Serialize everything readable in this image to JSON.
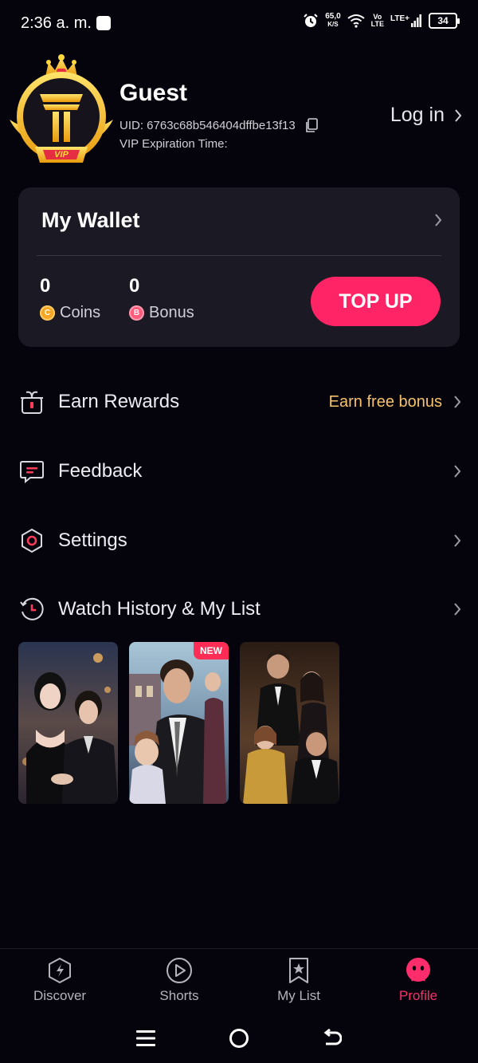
{
  "status_bar": {
    "time": "2:36 a. m.",
    "speed_value": "65,0",
    "speed_unit": "K/S",
    "volte_top": "Vo",
    "volte_bottom": "LTE",
    "lte": "LTE+",
    "battery": "34"
  },
  "profile": {
    "name": "Guest",
    "uid": "UID: 6763c68b546404dffbe13f13",
    "vip_expiration": "VIP Expiration Time:",
    "login_label": "Log in",
    "badge_label": "VIP"
  },
  "wallet": {
    "title": "My Wallet",
    "coins_value": "0",
    "coins_label": "Coins",
    "bonus_value": "0",
    "bonus_label": "Bonus",
    "coin_glyph": "C",
    "bonus_glyph": "B",
    "topup_label": "TOP UP"
  },
  "menu": {
    "earn_rewards": "Earn Rewards",
    "earn_hint": "Earn free bonus",
    "feedback": "Feedback",
    "settings": "Settings",
    "watch_history": "Watch History & My List"
  },
  "history": {
    "new_tag": "NEW"
  },
  "bottom_nav": {
    "discover": "Discover",
    "shorts": "Shorts",
    "my_list": "My List",
    "profile": "Profile"
  },
  "colors": {
    "background": "#05040d",
    "card": "#1b1a24",
    "accent": "#ff2466",
    "hint": "#f5c26b",
    "gold": "#f3c21a"
  }
}
